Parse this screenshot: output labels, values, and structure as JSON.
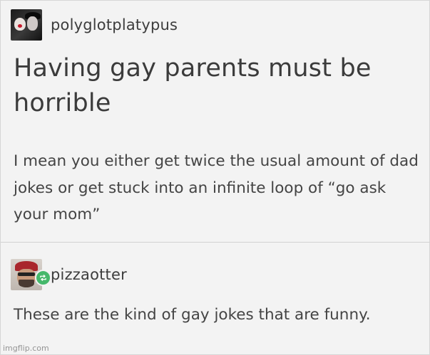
{
  "original_post": {
    "username": "polyglotplatypus",
    "title": "Having gay parents must be horrible",
    "body": "I mean you either get twice the usual amount of dad jokes or get stuck into an infinite loop of “go ask your mom”"
  },
  "reblog": {
    "username": "pizzaotter",
    "comment": "These are the kind of gay jokes that are funny."
  },
  "watermark": "imgflip.com",
  "colors": {
    "background": "#f3f3f3",
    "text": "#3e3e3e",
    "reblog_badge": "#45b86b",
    "divider": "#d2d2d2"
  },
  "icons": {
    "reblog_badge": "reblog-icon"
  }
}
